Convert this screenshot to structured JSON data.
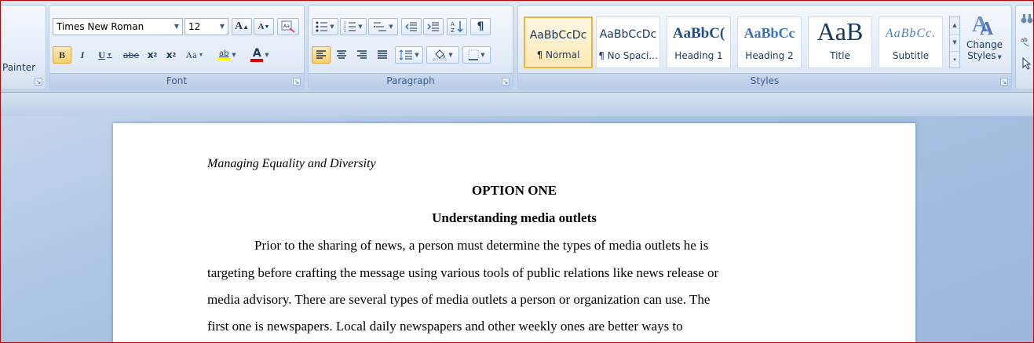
{
  "clipboard": {
    "painter_label": "Painter"
  },
  "font": {
    "group_label": "Font",
    "font_name": "Times New Roman",
    "font_size": "12",
    "grow_label": "A",
    "shrink_label": "A",
    "bold_label": "B",
    "italic_label": "I",
    "underline_label": "U",
    "strike_label": "abe",
    "subscript_label": "x",
    "superscript_label": "x",
    "case_label": "Aa",
    "highlight_label": "ab",
    "color_label": "A",
    "highlight_color": "#ffff00",
    "font_color": "#e00000"
  },
  "paragraph": {
    "group_label": "Paragraph",
    "pilcrow": "¶"
  },
  "styles": {
    "group_label": "Styles",
    "tiles": [
      {
        "sample": "AaBbCcDc",
        "name": "¶ Normal"
      },
      {
        "sample": "AaBbCcDc",
        "name": "¶ No Spaci..."
      },
      {
        "sample": "AaBbC(",
        "name": "Heading 1"
      },
      {
        "sample": "AaBbCc",
        "name": "Heading 2"
      },
      {
        "sample": "AaB",
        "name": "Title"
      },
      {
        "sample": "AaBbCc.",
        "name": "Subtitle"
      }
    ],
    "change_styles": {
      "line1": "Change",
      "line2": "Styles"
    }
  },
  "document": {
    "header": "Managing Equality and Diversity",
    "heading1": "OPTION ONE",
    "heading2": "Understanding media outlets",
    "lines": [
      "Prior to the sharing of news, a person must determine the types of media outlets he is",
      "targeting before crafting the message using various tools of public relations like news release or",
      "media advisory. There are several types of media outlets a person or organization can use. The",
      "first one is newspapers. Local daily newspapers and other weekly ones are better ways to"
    ]
  }
}
